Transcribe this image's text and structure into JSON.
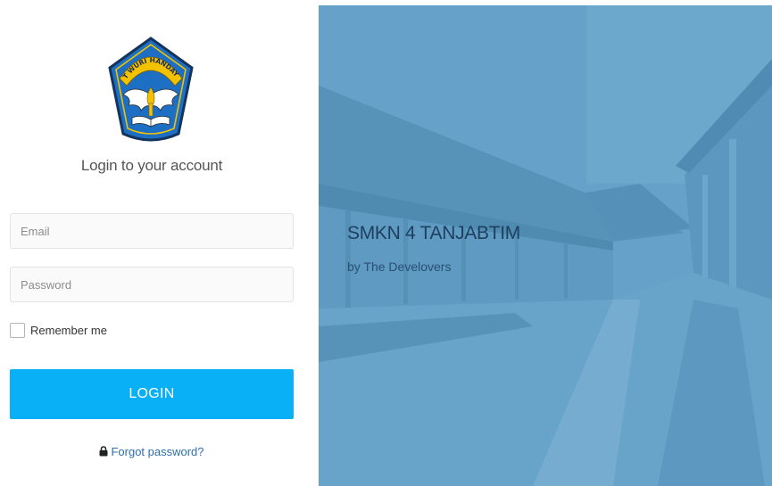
{
  "login_panel": {
    "title": "Login to your account",
    "email_placeholder": "Email",
    "password_placeholder": "Password",
    "remember_label": "Remember me",
    "login_button": "LOGIN",
    "forgot_link": "Forgot password?",
    "logo_text": "TUT WURI HANDAYANI"
  },
  "hero": {
    "school_name": "SMKN 4 TANJABTIM",
    "byline": "by The Develovers"
  },
  "colors": {
    "accent": "#0ab0f6",
    "link": "#2c6fad",
    "hero_overlay": "#5096c3",
    "logo_blue": "#1d6fc4",
    "logo_yellow": "#f2c200"
  },
  "icons": [
    "tut-wuri-handayani-logo",
    "lock-icon"
  ]
}
